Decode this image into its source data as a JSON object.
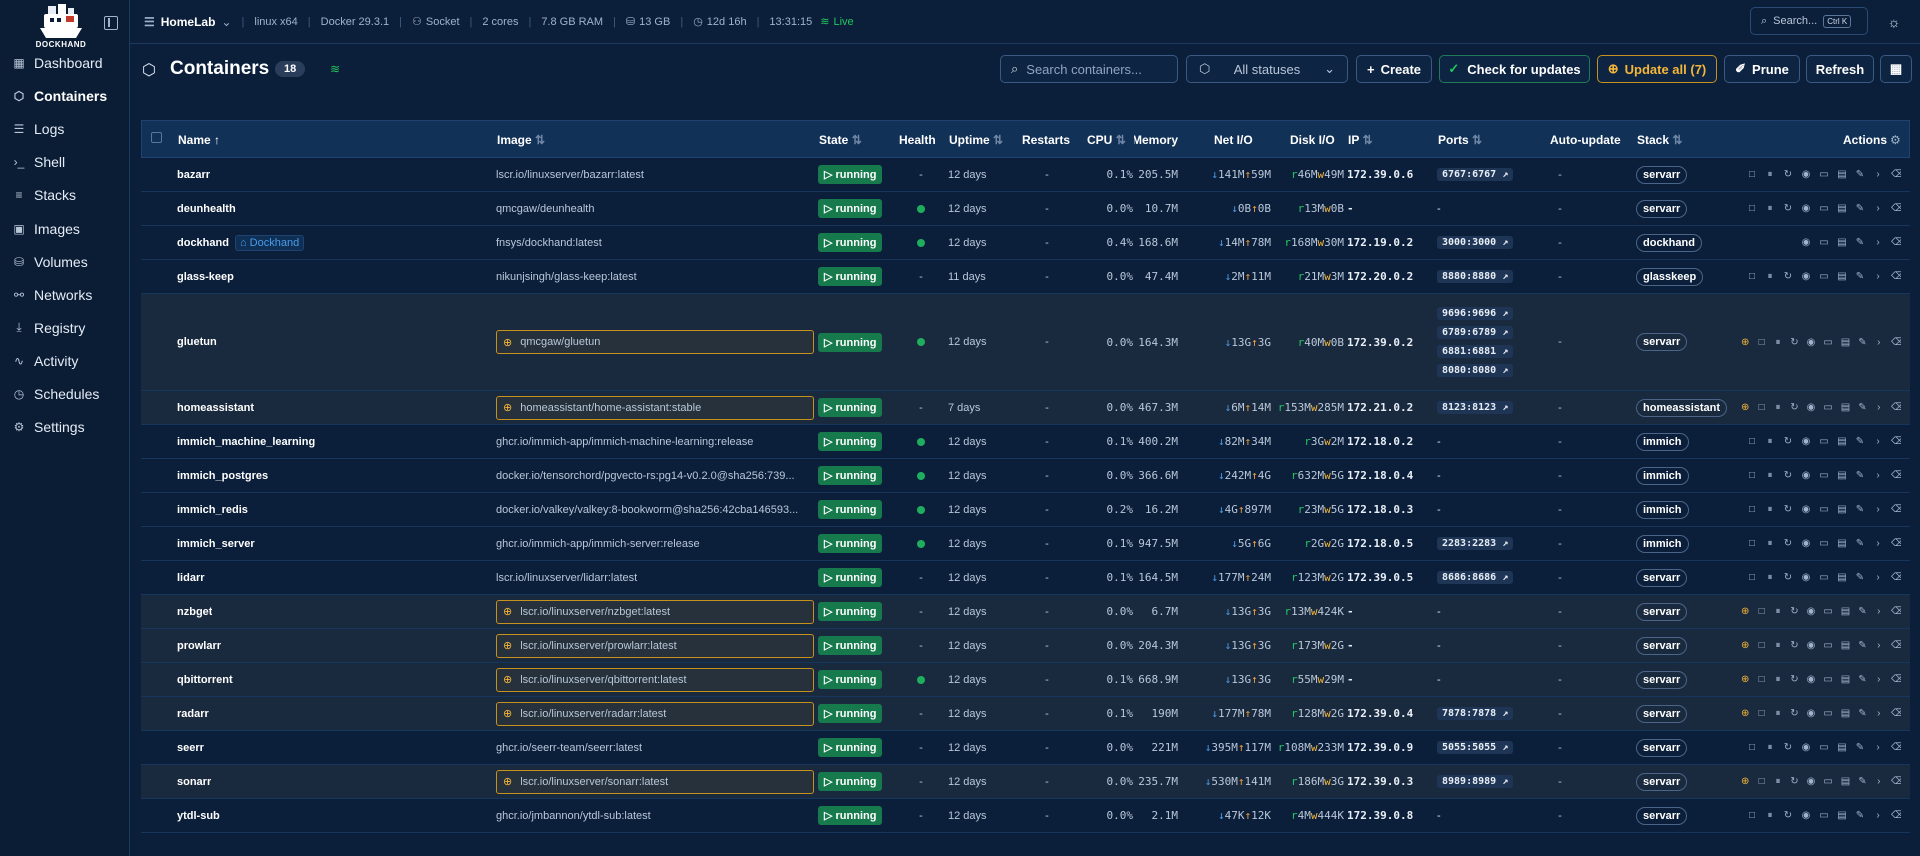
{
  "app": {
    "name": "DOCKHAND"
  },
  "sidebar": {
    "items": [
      {
        "label": "Dashboard",
        "icon": "dashboard-icon"
      },
      {
        "label": "Containers",
        "icon": "box-icon",
        "active": true
      },
      {
        "label": "Logs",
        "icon": "logs-icon"
      },
      {
        "label": "Shell",
        "icon": "terminal-icon"
      },
      {
        "label": "Stacks",
        "icon": "layers-icon"
      },
      {
        "label": "Images",
        "icon": "images-icon"
      },
      {
        "label": "Volumes",
        "icon": "database-icon"
      },
      {
        "label": "Networks",
        "icon": "network-icon"
      },
      {
        "label": "Registry",
        "icon": "download-icon"
      },
      {
        "label": "Activity",
        "icon": "activity-icon"
      },
      {
        "label": "Schedules",
        "icon": "clock-icon"
      },
      {
        "label": "Settings",
        "icon": "gear-icon"
      }
    ]
  },
  "topbar": {
    "environment": "HomeLab",
    "os": "linux x64",
    "docker": "Docker 29.3.1",
    "connection": "Socket",
    "cores": "2 cores",
    "ram": "7.8 GB RAM",
    "disk": "13 GB",
    "uptime": "12d 16h",
    "time": "13:31:15",
    "status": "Live",
    "search_label": "Search...",
    "search_kbd": "Ctrl K"
  },
  "header": {
    "title": "Containers",
    "count": "18",
    "search_placeholder": "Search containers...",
    "status_filter": "All statuses",
    "create": "Create",
    "check_updates": "Check for updates",
    "update_all": "Update all (7)",
    "prune": "Prune",
    "refresh": "Refresh"
  },
  "columns": {
    "name": "Name",
    "image": "Image",
    "state": "State",
    "health": "Health",
    "uptime": "Uptime",
    "restarts": "Restarts",
    "cpu": "CPU",
    "memory": "Memory",
    "net": "Net I/O",
    "disk": "Disk I/O",
    "ip": "IP",
    "ports": "Ports",
    "autoupdate": "Auto-update",
    "stack": "Stack",
    "actions": "Actions"
  },
  "containers": [
    {
      "name": "bazarr",
      "image": "lscr.io/linuxserver/bazarr:latest",
      "state": "running",
      "health": "-",
      "uptime": "12 days",
      "restarts": "-",
      "cpu": "0.1%",
      "mem": "205.5M",
      "net_rx": "141M",
      "net_tx": "59M",
      "disk_r": "46M",
      "disk_w": "49M",
      "ip": "172.39.0.6",
      "ports": [
        "6767:6767"
      ],
      "autoupdate": "-",
      "stack": "servarr",
      "update": false
    },
    {
      "name": "deunhealth",
      "image": "qmcgaw/deunhealth",
      "state": "running",
      "health": "dot",
      "uptime": "12 days",
      "restarts": "-",
      "cpu": "0.0%",
      "mem": "10.7M",
      "net_rx": "0B",
      "net_tx": "0B",
      "disk_r": "13M",
      "disk_w": "0B",
      "ip": "-",
      "ports": [],
      "autoupdate": "-",
      "stack": "servarr",
      "update": false
    },
    {
      "name": "dockhand",
      "badge": "Dockhand",
      "image": "fnsys/dockhand:latest",
      "state": "running",
      "health": "dot",
      "uptime": "12 days",
      "restarts": "-",
      "cpu": "0.4%",
      "mem": "168.6M",
      "net_rx": "14M",
      "net_tx": "78M",
      "disk_r": "168M",
      "disk_w": "30M",
      "ip": "172.19.0.2",
      "ports": [
        "3000:3000"
      ],
      "autoupdate": "-",
      "stack": "dockhand",
      "update": false
    },
    {
      "name": "glass-keep",
      "image": "nikunjsingh/glass-keep:latest",
      "state": "running",
      "health": "-",
      "uptime": "11 days",
      "restarts": "-",
      "cpu": "0.0%",
      "mem": "47.4M",
      "net_rx": "2M",
      "net_tx": "11M",
      "disk_r": "21M",
      "disk_w": "3M",
      "ip": "172.20.0.2",
      "ports": [
        "8880:8880"
      ],
      "autoupdate": "-",
      "stack": "glasskeep",
      "update": false
    },
    {
      "name": "gluetun",
      "image": "qmcgaw/gluetun",
      "state": "running",
      "health": "dot",
      "uptime": "12 days",
      "restarts": "-",
      "cpu": "0.0%",
      "mem": "164.3M",
      "net_rx": "13G",
      "net_tx": "3G",
      "disk_r": "40M",
      "disk_w": "0B",
      "ip": "172.39.0.2",
      "ports": [
        "9696:9696",
        "6789:6789",
        "6881:6881",
        "8080:8080"
      ],
      "autoupdate": "-",
      "stack": "servarr",
      "update": true
    },
    {
      "name": "homeassistant",
      "image": "homeassistant/home-assistant:stable",
      "state": "running",
      "health": "-",
      "uptime": "7 days",
      "restarts": "-",
      "cpu": "0.0%",
      "mem": "467.3M",
      "net_rx": "6M",
      "net_tx": "14M",
      "disk_r": "153M",
      "disk_w": "285M",
      "ip": "172.21.0.2",
      "ports": [
        "8123:8123"
      ],
      "autoupdate": "-",
      "stack": "homeassistant",
      "update": true
    },
    {
      "name": "immich_machine_learning",
      "image": "ghcr.io/immich-app/immich-machine-learning:release",
      "state": "running",
      "health": "dot",
      "uptime": "12 days",
      "restarts": "-",
      "cpu": "0.1%",
      "mem": "400.2M",
      "net_rx": "82M",
      "net_tx": "34M",
      "disk_r": "3G",
      "disk_w": "2M",
      "ip": "172.18.0.2",
      "ports": [],
      "autoupdate": "-",
      "stack": "immich",
      "update": false
    },
    {
      "name": "immich_postgres",
      "image": "docker.io/tensorchord/pgvecto-rs:pg14-v0.2.0@sha256:739...",
      "state": "running",
      "health": "dot",
      "uptime": "12 days",
      "restarts": "-",
      "cpu": "0.0%",
      "mem": "366.6M",
      "net_rx": "242M",
      "net_tx": "4G",
      "disk_r": "632M",
      "disk_w": "5G",
      "ip": "172.18.0.4",
      "ports": [],
      "autoupdate": "-",
      "stack": "immich",
      "update": false
    },
    {
      "name": "immich_redis",
      "image": "docker.io/valkey/valkey:8-bookworm@sha256:42cba146593...",
      "state": "running",
      "health": "dot",
      "uptime": "12 days",
      "restarts": "-",
      "cpu": "0.2%",
      "mem": "16.2M",
      "net_rx": "4G",
      "net_tx": "897M",
      "disk_r": "23M",
      "disk_w": "5G",
      "ip": "172.18.0.3",
      "ports": [],
      "autoupdate": "-",
      "stack": "immich",
      "update": false
    },
    {
      "name": "immich_server",
      "image": "ghcr.io/immich-app/immich-server:release",
      "state": "running",
      "health": "dot",
      "uptime": "12 days",
      "restarts": "-",
      "cpu": "0.1%",
      "mem": "947.5M",
      "net_rx": "5G",
      "net_tx": "6G",
      "disk_r": "2G",
      "disk_w": "2G",
      "ip": "172.18.0.5",
      "ports": [
        "2283:2283"
      ],
      "autoupdate": "-",
      "stack": "immich",
      "update": false
    },
    {
      "name": "lidarr",
      "image": "lscr.io/linuxserver/lidarr:latest",
      "state": "running",
      "health": "-",
      "uptime": "12 days",
      "restarts": "-",
      "cpu": "0.1%",
      "mem": "164.5M",
      "net_rx": "177M",
      "net_tx": "24M",
      "disk_r": "123M",
      "disk_w": "2G",
      "ip": "172.39.0.5",
      "ports": [
        "8686:8686"
      ],
      "autoupdate": "-",
      "stack": "servarr",
      "update": false
    },
    {
      "name": "nzbget",
      "image": "lscr.io/linuxserver/nzbget:latest",
      "state": "running",
      "health": "-",
      "uptime": "12 days",
      "restarts": "-",
      "cpu": "0.0%",
      "mem": "6.7M",
      "net_rx": "13G",
      "net_tx": "3G",
      "disk_r": "13M",
      "disk_w": "424K",
      "ip": "-",
      "ports": [],
      "autoupdate": "-",
      "stack": "servarr",
      "update": true
    },
    {
      "name": "prowlarr",
      "image": "lscr.io/linuxserver/prowlarr:latest",
      "state": "running",
      "health": "-",
      "uptime": "12 days",
      "restarts": "-",
      "cpu": "0.0%",
      "mem": "204.3M",
      "net_rx": "13G",
      "net_tx": "3G",
      "disk_r": "173M",
      "disk_w": "2G",
      "ip": "-",
      "ports": [],
      "autoupdate": "-",
      "stack": "servarr",
      "update": true
    },
    {
      "name": "qbittorrent",
      "image": "lscr.io/linuxserver/qbittorrent:latest",
      "state": "running",
      "health": "dot",
      "uptime": "12 days",
      "restarts": "-",
      "cpu": "0.1%",
      "mem": "668.9M",
      "net_rx": "13G",
      "net_tx": "3G",
      "disk_r": "55M",
      "disk_w": "29M",
      "ip": "-",
      "ports": [],
      "autoupdate": "-",
      "stack": "servarr",
      "update": true
    },
    {
      "name": "radarr",
      "image": "lscr.io/linuxserver/radarr:latest",
      "state": "running",
      "health": "-",
      "uptime": "12 days",
      "restarts": "-",
      "cpu": "0.1%",
      "mem": "190M",
      "net_rx": "177M",
      "net_tx": "78M",
      "disk_r": "128M",
      "disk_w": "2G",
      "ip": "172.39.0.4",
      "ports": [
        "7878:7878"
      ],
      "autoupdate": "-",
      "stack": "servarr",
      "update": true
    },
    {
      "name": "seerr",
      "image": "ghcr.io/seerr-team/seerr:latest",
      "state": "running",
      "health": "-",
      "uptime": "12 days",
      "restarts": "-",
      "cpu": "0.0%",
      "mem": "221M",
      "net_rx": "395M",
      "net_tx": "117M",
      "disk_r": "108M",
      "disk_w": "233M",
      "ip": "172.39.0.9",
      "ports": [
        "5055:5055"
      ],
      "autoupdate": "-",
      "stack": "servarr",
      "update": false
    },
    {
      "name": "sonarr",
      "image": "lscr.io/linuxserver/sonarr:latest",
      "state": "running",
      "health": "-",
      "uptime": "12 days",
      "restarts": "-",
      "cpu": "0.0%",
      "mem": "235.7M",
      "net_rx": "530M",
      "net_tx": "141M",
      "disk_r": "186M",
      "disk_w": "3G",
      "ip": "172.39.0.3",
      "ports": [
        "8989:8989"
      ],
      "autoupdate": "-",
      "stack": "servarr",
      "update": true
    },
    {
      "name": "ytdl-sub",
      "image": "ghcr.io/jmbannon/ytdl-sub:latest",
      "state": "running",
      "health": "-",
      "uptime": "12 days",
      "restarts": "-",
      "cpu": "0.0%",
      "mem": "2.1M",
      "net_rx": "47K",
      "net_tx": "12K",
      "disk_r": "4M",
      "disk_w": "444K",
      "ip": "172.39.0.8",
      "ports": [],
      "autoupdate": "-",
      "stack": "servarr",
      "update": false
    }
  ]
}
